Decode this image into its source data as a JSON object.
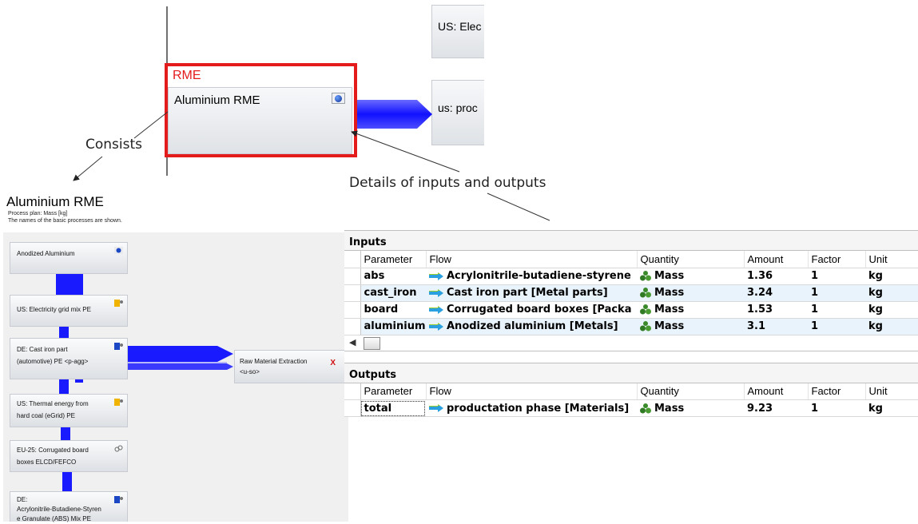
{
  "top": {
    "rme_label": "RME",
    "aluminium_process": "Aluminium RME",
    "us_elec_label": "US: Elec",
    "us_prod_label": "us: proc"
  },
  "annotations": {
    "consists": "Consists",
    "details": "Details of inputs and outputs"
  },
  "plan": {
    "title": "Aluminium RME",
    "subtitle_1": "Process plan: Mass [kg]",
    "subtitle_2": "The names of the basic processes are shown.",
    "boxes": {
      "anodized": "Anodized Aluminium",
      "us_elec": "US: Electricity grid mix PE",
      "cast_iron_1": "DE: Cast iron part",
      "cast_iron_2": "(automotive) PE <p-agg>",
      "thermal_1": "US: Thermal energy from",
      "thermal_2": "hard coal (eGrid) PE",
      "board_1": "EU-25: Corrugated board",
      "board_2": "boxes ELCD/FEFCO",
      "abs_1": "DE:",
      "abs_2": "Acrylonitrile-Butadiene-Styren",
      "abs_3": "e Granulate (ABS) Mix PE",
      "raw_1": "Raw Material Extraction",
      "raw_2": "<u-so>"
    }
  },
  "inputs": {
    "header": "Inputs",
    "columns": [
      "Parameter",
      "Flow",
      "Quantity",
      "Amount",
      "Factor",
      "Unit"
    ],
    "rows": [
      {
        "parameter": "abs",
        "flow": "Acrylonitrile-butadiene-styrene",
        "quantity": "Mass",
        "amount": "1.36",
        "factor": "1",
        "unit": "kg"
      },
      {
        "parameter": "cast_iron",
        "flow": "Cast iron part [Metal parts]",
        "quantity": "Mass",
        "amount": "3.24",
        "factor": "1",
        "unit": "kg"
      },
      {
        "parameter": "board",
        "flow": "Corrugated board boxes [Packa",
        "quantity": "Mass",
        "amount": "1.53",
        "factor": "1",
        "unit": "kg"
      },
      {
        "parameter": "aluminium",
        "flow": "Anodized aluminium [Metals]",
        "quantity": "Mass",
        "amount": "3.1",
        "factor": "1",
        "unit": "kg"
      }
    ]
  },
  "outputs": {
    "header": "Outputs",
    "columns": [
      "Parameter",
      "Flow",
      "Quantity",
      "Amount",
      "Factor",
      "Unit"
    ],
    "rows": [
      {
        "parameter": "total",
        "flow": "productation phase [Materials]",
        "quantity": "Mass",
        "amount": "9.23",
        "factor": "1",
        "unit": "kg"
      }
    ]
  },
  "colors": {
    "highlight": "#e31b1b",
    "flow": "#1a1aff",
    "row_alt": "#e9f3fb"
  }
}
